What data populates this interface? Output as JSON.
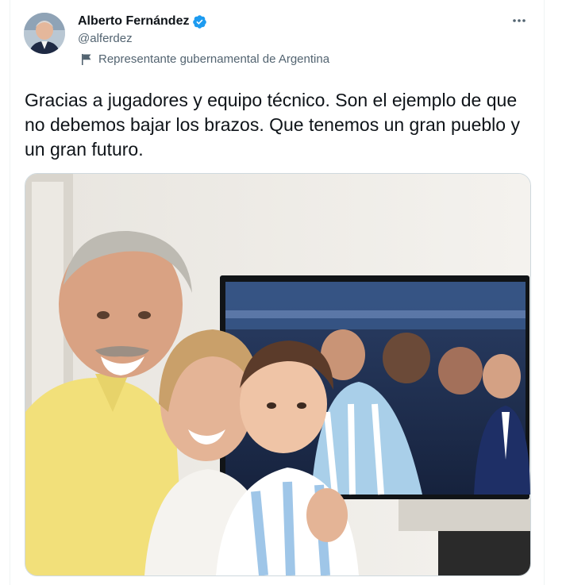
{
  "author": {
    "name": "Alberto Fernández",
    "handle": "@alferdez",
    "label": "Representante gubernamental de Argentina",
    "verified": true,
    "verified_icon": "verified-badge-icon",
    "label_icon": "flag-icon"
  },
  "tweet": {
    "text": "Gracias a jugadores y equipo técnico. Son el ejemplo de que no debemos bajar los brazos. Que tenemos un gran pueblo y un gran futuro."
  },
  "media": {
    "type": "photo"
  },
  "colors": {
    "accent": "#1d9bf0",
    "text_primary": "#0f1419",
    "text_secondary": "#536471",
    "border": "#cfd9de"
  }
}
